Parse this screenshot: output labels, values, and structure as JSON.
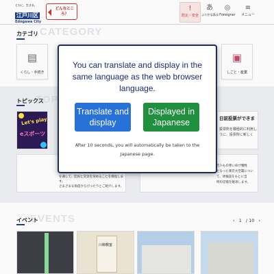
{
  "header": {
    "logo_tagline": "ともに、生きる。",
    "logo_kanji": "江戸川区",
    "logo_english": "Edogawa City",
    "promo_text": "どんなところ？",
    "nav": [
      {
        "label": "防災・安全",
        "icon": "alert-icon"
      },
      {
        "label": "ふりがな表示",
        "icon": "furigana-icon"
      },
      {
        "label": "Foreigner",
        "icon": "globe-icon"
      },
      {
        "label": "メニュー",
        "icon": "menu-icon"
      }
    ]
  },
  "category": {
    "heading": "カテゴリ",
    "bg_text": "CATEGORY",
    "items": [
      {
        "label": "くらし・手続き",
        "icon": "document-icon"
      },
      {
        "label": "しごと・産業",
        "icon": "briefcase-icon"
      }
    ]
  },
  "topics": {
    "heading": "トピックス",
    "bg_text": "TOPICS",
    "image_text_1": "Let's play!",
    "image_text_2": "eスポーツ",
    "right_title": "日前投票ができま",
    "right_text": "投票所を積極的に利用し\nうに、投票所に新しく",
    "lower_right_text": "万人もの寒い命が犠牲\nとなった東京大空襲について、体験談をもとに当\n時の記憶を継承します。",
    "lower_left_text": "を通して、区民と交流を深めることを目指します。\nさまざまな角度からぴったりとご紹介します。"
  },
  "events": {
    "heading": "イベント",
    "bg_text": "EVENTS",
    "pager_current": "1",
    "pager_total": "/ 10",
    "prev": "‹",
    "next": "›",
    "poster_title": "川柳教室"
  },
  "modal": {
    "message": "You can translate and display in the same language as the web browser language.",
    "translate_button": "Translate and display",
    "japanese_button": "Displayed in Japanese",
    "note": "After 10 seconds, you will automatically be taken to the Japanese page."
  },
  "colors": {
    "brand": "#1f3e8c",
    "translate": "#2871d9",
    "japanese": "#21903e",
    "modal_border": "#1f2a5e",
    "alert": "#cc3333"
  }
}
